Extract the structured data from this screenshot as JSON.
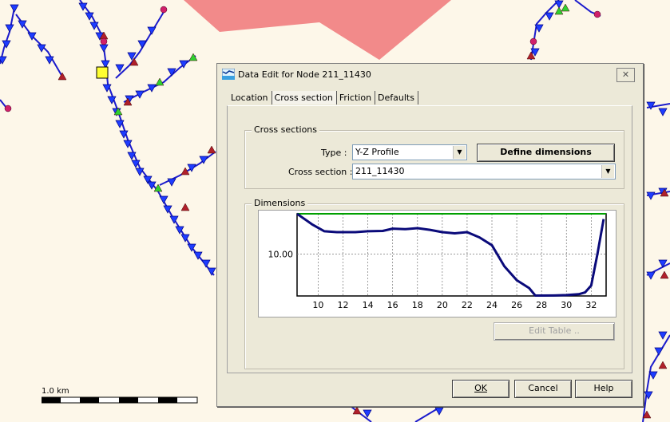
{
  "map": {
    "scale_label": "1.0 km",
    "colors": {
      "background": "#fdf7e9",
      "river": "#1a1acc",
      "node_down": "#1e3cff",
      "node_red": "#b0202a",
      "node_green": "#30d030",
      "node_pink": "#d0206a",
      "area": "#f28a8a"
    }
  },
  "dialog": {
    "title": "Data Edit for Node 211_11430",
    "close_label": "✕",
    "icon": "network-icon",
    "tabs": [
      {
        "label": "Location"
      },
      {
        "label": "Cross section"
      },
      {
        "label": "Friction"
      },
      {
        "label": "Defaults"
      }
    ],
    "cross_sections": {
      "group_label": "Cross sections",
      "type_label": "Type :",
      "type_value": "Y-Z Profile",
      "define_button": "Define dimensions",
      "section_label": "Cross section :",
      "section_value": "211_11430"
    },
    "dimensions": {
      "group_label": "Dimensions",
      "edit_table_button": "Edit Table .."
    },
    "buttons": {
      "ok": "OK",
      "cancel": "Cancel",
      "help": "Help"
    }
  },
  "chart_data": {
    "type": "line",
    "title": "",
    "xlabel": "",
    "ylabel": "",
    "xlim": [
      8.3,
      33.2
    ],
    "ylim": [
      7.6,
      12.3
    ],
    "x_ticks": [
      10,
      12,
      14,
      16,
      18,
      20,
      22,
      24,
      26,
      28,
      30,
      32
    ],
    "y_ticks": [
      10.0
    ],
    "y_tick_labels": [
      "10.00"
    ],
    "grid": true,
    "reference_line": {
      "y": 12.3,
      "color": "#00a000"
    },
    "series": [
      {
        "color": "#0a0a7a",
        "x": [
          8.3,
          9.5,
          10.5,
          11.5,
          13,
          14,
          15.2,
          16,
          17,
          18,
          19,
          20,
          21,
          22,
          23,
          24,
          25,
          26,
          27,
          27.5,
          28,
          29,
          30,
          31,
          31.5,
          32,
          32.5,
          33
        ],
        "y": [
          12.3,
          11.7,
          11.3,
          11.25,
          11.25,
          11.3,
          11.32,
          11.45,
          11.42,
          11.48,
          11.38,
          11.25,
          11.18,
          11.25,
          10.95,
          10.5,
          9.3,
          8.5,
          8.05,
          7.62,
          7.62,
          7.63,
          7.65,
          7.7,
          7.8,
          8.2,
          10.0,
          12.0
        ]
      }
    ]
  }
}
